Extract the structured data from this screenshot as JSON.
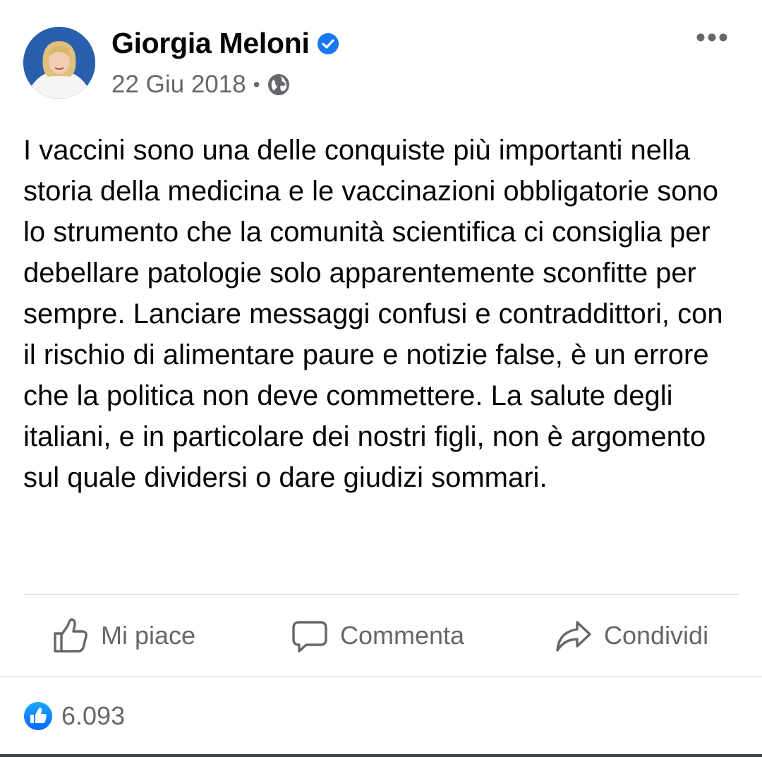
{
  "post": {
    "author": "Giorgia Meloni",
    "date": "22 Giu 2018",
    "separator": "•",
    "text": "I vaccini sono una delle conquiste più importanti nella storia della medicina e le vaccinazioni obbligatorie sono lo strumento che la comunità scientifica ci consiglia per debellare patologie solo apparentemente sconfitte per sempre. Lanciare messaggi confusi e contraddittori, con il rischio di alimentare paure e notizie false, è un errore che la politica non deve commettere. La salute degli italiani, e in particolare dei nostri figli, non è argomento sul quale dividersi o dare giudizi sommari."
  },
  "actions": {
    "like": "Mi piace",
    "comment": "Commenta",
    "share": "Condividi"
  },
  "reactions": {
    "count": "6.093"
  },
  "icons": {
    "verified": "verified-badge-icon",
    "audience": "globe-icon",
    "more": "more-options-icon",
    "like": "thumbs-up-icon",
    "comment": "comment-bubble-icon",
    "share": "share-arrow-icon",
    "reaction": "like-reaction-icon"
  },
  "colors": {
    "accent": "#1877f2",
    "secondary_text": "#65676b",
    "primary_text": "#050505"
  }
}
